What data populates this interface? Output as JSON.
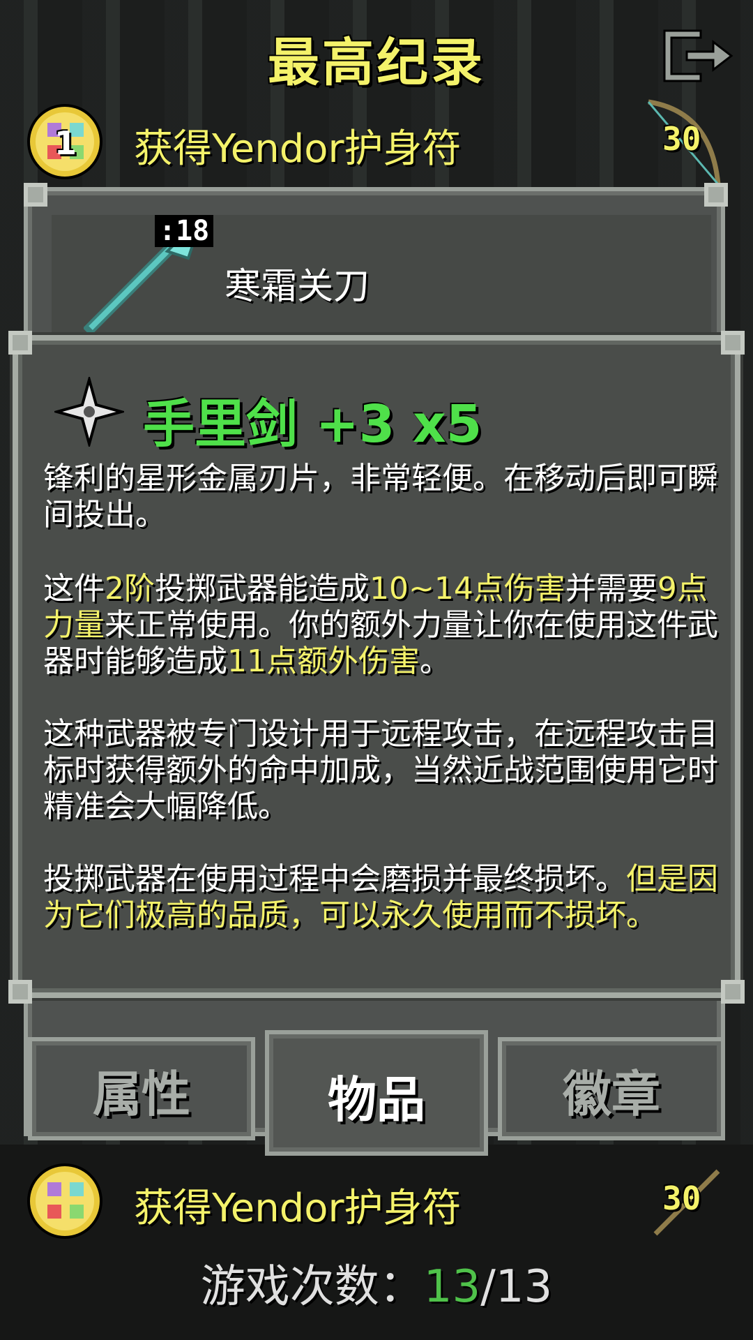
{
  "header": {
    "title": "最高纪录"
  },
  "records": [
    {
      "rank": "1",
      "label": "获得Yendor护身符",
      "depth": "30"
    },
    {
      "rank": "",
      "label": "获得Yendor护身符",
      "depth": "30"
    }
  ],
  "item_row": {
    "level": ":18",
    "name": "寒霜关刀"
  },
  "info": {
    "title": "手里剑 +3 x5",
    "p1": "锋利的星形金属刃片，非常轻便。在移动后即可瞬间投出。",
    "p2": {
      "t1": "这件",
      "h1": "2阶",
      "t2": "投掷武器能造成",
      "h2": "10~14点伤害",
      "t3": "并需要",
      "h3": "9点力量",
      "t4": "来正常使用。你的额外力量让你在使用这件武器时能够造成",
      "h4": "11点额外伤害",
      "t5": "。"
    },
    "p3": "这种武器被专门设计用于远程攻击，在远程攻击目标时获得额外的命中加成，当然近战范围使用它时精准会大幅降低。",
    "p4": {
      "t1": "投掷武器在使用过程中会磨损并最终损坏。",
      "h1": "但是因为它们极高的品质，可以永久使用而不损坏。"
    }
  },
  "tabs": [
    {
      "label": "属性",
      "active": false
    },
    {
      "label": "物品",
      "active": true
    },
    {
      "label": "徽章",
      "active": false
    }
  ],
  "stats": {
    "label": "游戏次数：",
    "won": "13",
    "sep": "/",
    "total": "13"
  },
  "colors": {
    "yellow": "#f4f26a",
    "green": "#4fe04a",
    "border": "#a5aba4"
  }
}
